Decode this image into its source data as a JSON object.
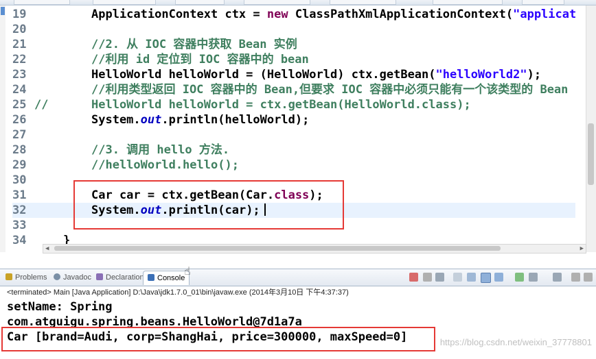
{
  "editor": {
    "lines": [
      {
        "num": "19",
        "prefix": "",
        "parts": [
          {
            "t": "ApplicationContext ctx = ",
            "c": ""
          },
          {
            "t": "new",
            "c": "kw"
          },
          {
            "t": " ClassPathXmlApplicationContext(",
            "c": ""
          },
          {
            "t": "\"applicat",
            "c": "str"
          }
        ]
      },
      {
        "num": "20",
        "prefix": "",
        "parts": []
      },
      {
        "num": "21",
        "prefix": "",
        "parts": [
          {
            "t": "//2. 从 IOC 容器中获取 Bean 实例",
            "c": "cmt"
          }
        ]
      },
      {
        "num": "22",
        "prefix": "",
        "parts": [
          {
            "t": "//利用 id 定位到 IOC 容器中的 bean",
            "c": "cmt"
          }
        ]
      },
      {
        "num": "23",
        "prefix": "",
        "parts": [
          {
            "t": "HelloWorld helloWorld = (HelloWorld) ctx.getBean(",
            "c": ""
          },
          {
            "t": "\"helloWorld2\"",
            "c": "str"
          },
          {
            "t": ");",
            "c": ""
          }
        ]
      },
      {
        "num": "24",
        "prefix": "",
        "parts": [
          {
            "t": "//利用类型返回 IOC 容器中的 Bean,但要求 IOC 容器中必须只能有一个该类型的 Bean",
            "c": "cmt"
          }
        ]
      },
      {
        "num": "25",
        "prefix": "//",
        "parts": [
          {
            "t": "HelloWorld helloWorld = ctx.getBean(HelloWorld.class);",
            "c": "cmt"
          }
        ]
      },
      {
        "num": "26",
        "prefix": "",
        "parts": [
          {
            "t": "System.",
            "c": ""
          },
          {
            "t": "out",
            "c": "ital"
          },
          {
            "t": ".println(helloWorld);",
            "c": ""
          }
        ]
      },
      {
        "num": "27",
        "prefix": "",
        "parts": []
      },
      {
        "num": "28",
        "prefix": "",
        "parts": [
          {
            "t": "//3. 调用 hello 方法.",
            "c": "cmt"
          }
        ]
      },
      {
        "num": "29",
        "prefix": "",
        "parts": [
          {
            "t": "//helloWorld.hello();",
            "c": "cmt"
          }
        ]
      },
      {
        "num": "30",
        "prefix": "",
        "parts": []
      },
      {
        "num": "31",
        "prefix": "",
        "parts": [
          {
            "t": "Car car = ctx.getBean(Car.",
            "c": ""
          },
          {
            "t": "class",
            "c": "kw"
          },
          {
            "t": ");",
            "c": ""
          }
        ]
      },
      {
        "num": "32",
        "prefix": "",
        "parts": [
          {
            "t": "System.",
            "c": ""
          },
          {
            "t": "out",
            "c": "ital"
          },
          {
            "t": ".println(car);",
            "c": ""
          }
        ],
        "current": true
      },
      {
        "num": "33",
        "prefix": "",
        "parts": []
      },
      {
        "num": "34",
        "prefix": "",
        "parts": [
          {
            "t": "}",
            "c": ""
          }
        ],
        "indent": "shallow"
      }
    ]
  },
  "views": {
    "tabs": [
      {
        "label": "Problems",
        "icon": "problems-icon",
        "color": "#c9a227"
      },
      {
        "label": "Javadoc",
        "icon": "javadoc-icon",
        "color": "#7a8fa6"
      },
      {
        "label": "Declaration",
        "icon": "declaration-icon",
        "color": "#8a6fb5"
      },
      {
        "label": "Console",
        "icon": "console-icon",
        "color": "#3b6fb6",
        "active": true
      }
    ]
  },
  "console": {
    "info": "<terminated> Main [Java Application] D:\\Java\\jdk1.7.0_01\\bin\\javaw.exe (2014年3月10日 下午4:37:37)",
    "output": [
      "setName: Spring",
      "com.atguigu.spring.beans.HelloWorld@7d1a7a",
      "Car [brand=Audi, corp=ShangHai, price=300000, maxSpeed=0]"
    ]
  },
  "watermark": "https://blog.csdn.net/weixin_37778801",
  "colors": {
    "highlight_box": "#e53935",
    "keyword": "#7f0055",
    "string": "#2a00ff",
    "comment": "#3f7f5f"
  }
}
